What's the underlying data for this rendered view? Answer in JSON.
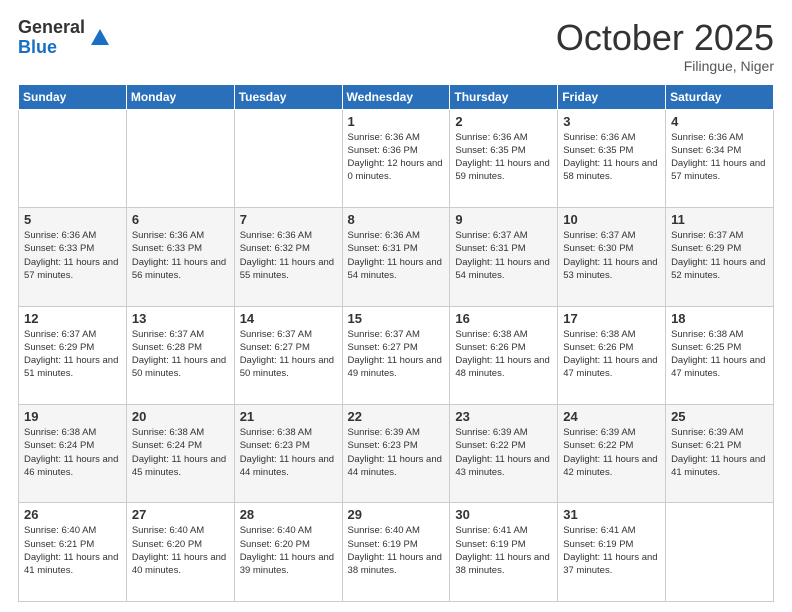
{
  "header": {
    "logo_general": "General",
    "logo_blue": "Blue",
    "month_title": "October 2025",
    "location": "Filingue, Niger"
  },
  "weekdays": [
    "Sunday",
    "Monday",
    "Tuesday",
    "Wednesday",
    "Thursday",
    "Friday",
    "Saturday"
  ],
  "weeks": [
    [
      {
        "day": "",
        "info": ""
      },
      {
        "day": "",
        "info": ""
      },
      {
        "day": "",
        "info": ""
      },
      {
        "day": "1",
        "info": "Sunrise: 6:36 AM\nSunset: 6:36 PM\nDaylight: 12 hours\nand 0 minutes."
      },
      {
        "day": "2",
        "info": "Sunrise: 6:36 AM\nSunset: 6:35 PM\nDaylight: 11 hours\nand 59 minutes."
      },
      {
        "day": "3",
        "info": "Sunrise: 6:36 AM\nSunset: 6:35 PM\nDaylight: 11 hours\nand 58 minutes."
      },
      {
        "day": "4",
        "info": "Sunrise: 6:36 AM\nSunset: 6:34 PM\nDaylight: 11 hours\nand 57 minutes."
      }
    ],
    [
      {
        "day": "5",
        "info": "Sunrise: 6:36 AM\nSunset: 6:33 PM\nDaylight: 11 hours\nand 57 minutes."
      },
      {
        "day": "6",
        "info": "Sunrise: 6:36 AM\nSunset: 6:33 PM\nDaylight: 11 hours\nand 56 minutes."
      },
      {
        "day": "7",
        "info": "Sunrise: 6:36 AM\nSunset: 6:32 PM\nDaylight: 11 hours\nand 55 minutes."
      },
      {
        "day": "8",
        "info": "Sunrise: 6:36 AM\nSunset: 6:31 PM\nDaylight: 11 hours\nand 54 minutes."
      },
      {
        "day": "9",
        "info": "Sunrise: 6:37 AM\nSunset: 6:31 PM\nDaylight: 11 hours\nand 54 minutes."
      },
      {
        "day": "10",
        "info": "Sunrise: 6:37 AM\nSunset: 6:30 PM\nDaylight: 11 hours\nand 53 minutes."
      },
      {
        "day": "11",
        "info": "Sunrise: 6:37 AM\nSunset: 6:29 PM\nDaylight: 11 hours\nand 52 minutes."
      }
    ],
    [
      {
        "day": "12",
        "info": "Sunrise: 6:37 AM\nSunset: 6:29 PM\nDaylight: 11 hours\nand 51 minutes."
      },
      {
        "day": "13",
        "info": "Sunrise: 6:37 AM\nSunset: 6:28 PM\nDaylight: 11 hours\nand 50 minutes."
      },
      {
        "day": "14",
        "info": "Sunrise: 6:37 AM\nSunset: 6:27 PM\nDaylight: 11 hours\nand 50 minutes."
      },
      {
        "day": "15",
        "info": "Sunrise: 6:37 AM\nSunset: 6:27 PM\nDaylight: 11 hours\nand 49 minutes."
      },
      {
        "day": "16",
        "info": "Sunrise: 6:38 AM\nSunset: 6:26 PM\nDaylight: 11 hours\nand 48 minutes."
      },
      {
        "day": "17",
        "info": "Sunrise: 6:38 AM\nSunset: 6:26 PM\nDaylight: 11 hours\nand 47 minutes."
      },
      {
        "day": "18",
        "info": "Sunrise: 6:38 AM\nSunset: 6:25 PM\nDaylight: 11 hours\nand 47 minutes."
      }
    ],
    [
      {
        "day": "19",
        "info": "Sunrise: 6:38 AM\nSunset: 6:24 PM\nDaylight: 11 hours\nand 46 minutes."
      },
      {
        "day": "20",
        "info": "Sunrise: 6:38 AM\nSunset: 6:24 PM\nDaylight: 11 hours\nand 45 minutes."
      },
      {
        "day": "21",
        "info": "Sunrise: 6:38 AM\nSunset: 6:23 PM\nDaylight: 11 hours\nand 44 minutes."
      },
      {
        "day": "22",
        "info": "Sunrise: 6:39 AM\nSunset: 6:23 PM\nDaylight: 11 hours\nand 44 minutes."
      },
      {
        "day": "23",
        "info": "Sunrise: 6:39 AM\nSunset: 6:22 PM\nDaylight: 11 hours\nand 43 minutes."
      },
      {
        "day": "24",
        "info": "Sunrise: 6:39 AM\nSunset: 6:22 PM\nDaylight: 11 hours\nand 42 minutes."
      },
      {
        "day": "25",
        "info": "Sunrise: 6:39 AM\nSunset: 6:21 PM\nDaylight: 11 hours\nand 41 minutes."
      }
    ],
    [
      {
        "day": "26",
        "info": "Sunrise: 6:40 AM\nSunset: 6:21 PM\nDaylight: 11 hours\nand 41 minutes."
      },
      {
        "day": "27",
        "info": "Sunrise: 6:40 AM\nSunset: 6:20 PM\nDaylight: 11 hours\nand 40 minutes."
      },
      {
        "day": "28",
        "info": "Sunrise: 6:40 AM\nSunset: 6:20 PM\nDaylight: 11 hours\nand 39 minutes."
      },
      {
        "day": "29",
        "info": "Sunrise: 6:40 AM\nSunset: 6:19 PM\nDaylight: 11 hours\nand 38 minutes."
      },
      {
        "day": "30",
        "info": "Sunrise: 6:41 AM\nSunset: 6:19 PM\nDaylight: 11 hours\nand 38 minutes."
      },
      {
        "day": "31",
        "info": "Sunrise: 6:41 AM\nSunset: 6:19 PM\nDaylight: 11 hours\nand 37 minutes."
      },
      {
        "day": "",
        "info": ""
      }
    ]
  ]
}
